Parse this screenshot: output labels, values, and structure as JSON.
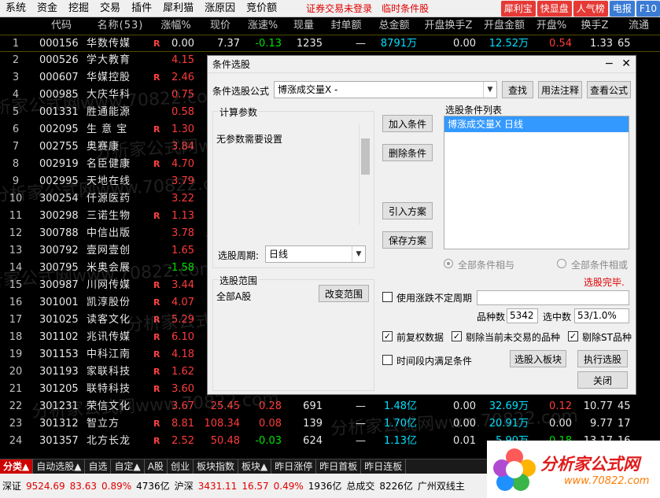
{
  "menu": {
    "items": [
      "系统",
      "资金",
      "挖掘",
      "交易",
      "插件",
      "犀利猫",
      "涨原因",
      "竞价额"
    ],
    "alert_login": "证券交易未登录",
    "alert_cond": "临时条件股",
    "pills": [
      "犀利宝",
      "快显盘",
      "人气榜",
      "电报",
      "F10"
    ]
  },
  "table": {
    "headers": [
      "",
      "代码",
      "名称(53)",
      "",
      "涨幅%",
      "现价",
      "涨速%",
      "现量",
      "封单额",
      "总金额",
      "开盘换手Z",
      "开盘金额",
      "开盘%",
      "换手Z",
      "流通"
    ],
    "rows": [
      {
        "idx": "1",
        "code": "000156",
        "name": "华数传媒",
        "r": "R",
        "chg": "0.00",
        "price": "7.37",
        "speed": "-0.13",
        "vol": "1235",
        "seal": "—",
        "amt": "8791万",
        "tor": "0.00",
        "oamt": "12.52万",
        "opct": "0.54",
        "turn": "1.33",
        "flow": "65",
        "dir": "flat",
        "pdir": "flat",
        "sdir": "dn",
        "odir": "up"
      },
      {
        "idx": "2",
        "code": "000526",
        "name": "学大教育",
        "r": "",
        "chg": "4.15",
        "price": "",
        "speed": "",
        "vol": "",
        "seal": "",
        "amt": "",
        "tor": "",
        "oamt": "",
        "opct": "",
        "turn": "",
        "flow": "",
        "dir": "up",
        "pdir": "up",
        "sdir": "up",
        "odir": "up"
      },
      {
        "idx": "3",
        "code": "000607",
        "name": "华媒控股",
        "r": "R",
        "chg": "2.46",
        "price": "",
        "speed": "",
        "vol": "",
        "seal": "",
        "amt": "",
        "tor": "",
        "oamt": "",
        "opct": "",
        "turn": "",
        "flow": "",
        "dir": "up",
        "pdir": "up",
        "sdir": "up",
        "odir": "up"
      },
      {
        "idx": "4",
        "code": "000985",
        "name": "大庆华科",
        "r": "",
        "chg": "0.75",
        "price": "",
        "speed": "",
        "vol": "",
        "seal": "",
        "amt": "",
        "tor": "",
        "oamt": "",
        "opct": "",
        "turn": "",
        "flow": "",
        "dir": "up",
        "pdir": "up",
        "sdir": "up",
        "odir": "up"
      },
      {
        "idx": "5",
        "code": "001331",
        "name": "胜通能源",
        "r": "",
        "chg": "0.58",
        "price": "",
        "speed": "",
        "vol": "",
        "seal": "",
        "amt": "",
        "tor": "",
        "oamt": "",
        "opct": "",
        "turn": "",
        "flow": "",
        "dir": "up",
        "pdir": "up",
        "sdir": "up",
        "odir": "up"
      },
      {
        "idx": "6",
        "code": "002095",
        "name": "生 意 宝",
        "r": "R",
        "chg": "1.30",
        "price": "",
        "speed": "",
        "vol": "",
        "seal": "",
        "amt": "",
        "tor": "",
        "oamt": "",
        "opct": "",
        "turn": "",
        "flow": "",
        "dir": "up",
        "pdir": "up",
        "sdir": "up",
        "odir": "up"
      },
      {
        "idx": "7",
        "code": "002755",
        "name": "奥赛康",
        "r": "",
        "chg": "3.84",
        "price": "",
        "speed": "",
        "vol": "",
        "seal": "",
        "amt": "",
        "tor": "",
        "oamt": "",
        "opct": "",
        "turn": "",
        "flow": "",
        "dir": "up",
        "pdir": "up",
        "sdir": "up",
        "odir": "up"
      },
      {
        "idx": "8",
        "code": "002919",
        "name": "名臣健康",
        "r": "R",
        "chg": "4.70",
        "price": "",
        "speed": "",
        "vol": "",
        "seal": "",
        "amt": "",
        "tor": "",
        "oamt": "",
        "opct": "",
        "turn": "",
        "flow": "",
        "dir": "up",
        "pdir": "up",
        "sdir": "up",
        "odir": "up"
      },
      {
        "idx": "9",
        "code": "002995",
        "name": "天地在线",
        "r": "",
        "chg": "3.79",
        "price": "",
        "speed": "",
        "vol": "",
        "seal": "",
        "amt": "",
        "tor": "",
        "oamt": "",
        "opct": "",
        "turn": "",
        "flow": "",
        "dir": "up",
        "pdir": "up",
        "sdir": "up",
        "odir": "up"
      },
      {
        "idx": "10",
        "code": "300254",
        "name": "仟源医药",
        "r": "",
        "chg": "3.22",
        "price": "",
        "speed": "",
        "vol": "",
        "seal": "",
        "amt": "",
        "tor": "",
        "oamt": "",
        "opct": "",
        "turn": "",
        "flow": "",
        "dir": "up",
        "pdir": "up",
        "sdir": "up",
        "odir": "up"
      },
      {
        "idx": "11",
        "code": "300298",
        "name": "三诺生物",
        "r": "R",
        "chg": "1.13",
        "price": "",
        "speed": "",
        "vol": "",
        "seal": "",
        "amt": "",
        "tor": "",
        "oamt": "",
        "opct": "",
        "turn": "",
        "flow": "",
        "dir": "up",
        "pdir": "up",
        "sdir": "up",
        "odir": "up"
      },
      {
        "idx": "12",
        "code": "300788",
        "name": "中信出版",
        "r": "",
        "chg": "3.78",
        "price": "",
        "speed": "",
        "vol": "",
        "seal": "",
        "amt": "",
        "tor": "",
        "oamt": "",
        "opct": "",
        "turn": "",
        "flow": "",
        "dir": "up",
        "pdir": "up",
        "sdir": "up",
        "odir": "up"
      },
      {
        "idx": "13",
        "code": "300792",
        "name": "壹网壹创",
        "r": "",
        "chg": "1.65",
        "price": "",
        "speed": "",
        "vol": "",
        "seal": "",
        "amt": "",
        "tor": "",
        "oamt": "",
        "opct": "",
        "turn": "",
        "flow": "",
        "dir": "up",
        "pdir": "up",
        "sdir": "up",
        "odir": "up"
      },
      {
        "idx": "14",
        "code": "300795",
        "name": "米奥会展",
        "r": "",
        "chg": "-1.58",
        "price": "",
        "speed": "",
        "vol": "",
        "seal": "",
        "amt": "",
        "tor": "",
        "oamt": "",
        "opct": "",
        "turn": "",
        "flow": "",
        "dir": "dn",
        "pdir": "dn",
        "sdir": "dn",
        "odir": "dn"
      },
      {
        "idx": "15",
        "code": "300987",
        "name": "川网传媒",
        "r": "R",
        "chg": "3.44",
        "price": "",
        "speed": "",
        "vol": "",
        "seal": "",
        "amt": "",
        "tor": "",
        "oamt": "",
        "opct": "",
        "turn": "",
        "flow": "",
        "dir": "up",
        "pdir": "up",
        "sdir": "up",
        "odir": "up"
      },
      {
        "idx": "16",
        "code": "301001",
        "name": "凯淳股份",
        "r": "R",
        "chg": "4.07",
        "price": "",
        "speed": "",
        "vol": "",
        "seal": "",
        "amt": "",
        "tor": "",
        "oamt": "",
        "opct": "",
        "turn": "",
        "flow": "",
        "dir": "up",
        "pdir": "up",
        "sdir": "up",
        "odir": "up"
      },
      {
        "idx": "17",
        "code": "301025",
        "name": "读客文化",
        "r": "R",
        "chg": "5.29",
        "price": "",
        "speed": "",
        "vol": "",
        "seal": "",
        "amt": "",
        "tor": "",
        "oamt": "",
        "opct": "",
        "turn": "",
        "flow": "",
        "dir": "up",
        "pdir": "up",
        "sdir": "up",
        "odir": "up"
      },
      {
        "idx": "18",
        "code": "301102",
        "name": "兆讯传媒",
        "r": "R",
        "chg": "6.10",
        "price": "",
        "speed": "",
        "vol": "",
        "seal": "",
        "amt": "",
        "tor": "",
        "oamt": "",
        "opct": "",
        "turn": "",
        "flow": "",
        "dir": "up",
        "pdir": "up",
        "sdir": "up",
        "odir": "up"
      },
      {
        "idx": "19",
        "code": "301153",
        "name": "中科江南",
        "r": "R",
        "chg": "4.18",
        "price": "",
        "speed": "",
        "vol": "",
        "seal": "",
        "amt": "",
        "tor": "",
        "oamt": "",
        "opct": "",
        "turn": "",
        "flow": "",
        "dir": "up",
        "pdir": "up",
        "sdir": "up",
        "odir": "up"
      },
      {
        "idx": "20",
        "code": "301193",
        "name": "家联科技",
        "r": "R",
        "chg": "1.62",
        "price": "",
        "speed": "",
        "vol": "",
        "seal": "",
        "amt": "",
        "tor": "",
        "oamt": "",
        "opct": "",
        "turn": "",
        "flow": "",
        "dir": "up",
        "pdir": "up",
        "sdir": "up",
        "odir": "up"
      },
      {
        "idx": "21",
        "code": "301205",
        "name": "联特科技",
        "r": "R",
        "chg": "3.60",
        "price": "",
        "speed": "",
        "vol": "",
        "seal": "",
        "amt": "",
        "tor": "",
        "oamt": "",
        "opct": "",
        "turn": "",
        "flow": "",
        "dir": "up",
        "pdir": "up",
        "sdir": "up",
        "odir": "up"
      },
      {
        "idx": "22",
        "code": "301231",
        "name": "荣信文化",
        "r": "",
        "chg": "3.67",
        "price": "25.45",
        "speed": "0.28",
        "vol": "691",
        "seal": "—",
        "amt": "1.48亿",
        "tor": "0.00",
        "oamt": "32.69万",
        "opct": "0.12",
        "turn": "10.77",
        "flow": "45",
        "dir": "up",
        "pdir": "up",
        "sdir": "up",
        "odir": "up"
      },
      {
        "idx": "23",
        "code": "301312",
        "name": "智立方",
        "r": "R",
        "chg": "8.81",
        "price": "108.34",
        "speed": "0.08",
        "vol": "139",
        "seal": "—",
        "amt": "1.70亿",
        "tor": "0.00",
        "oamt": "20.91万",
        "opct": "0.00",
        "turn": "9.77",
        "flow": "17",
        "dir": "up",
        "pdir": "up",
        "sdir": "up",
        "odir": "flat"
      },
      {
        "idx": "24",
        "code": "301357",
        "name": "北方长龙",
        "r": "R",
        "chg": "2.52",
        "price": "50.48",
        "speed": "-0.03",
        "vol": "624",
        "seal": "—",
        "amt": "1.13亿",
        "tor": "0.01",
        "oamt": "5.90万",
        "opct": "-0.18",
        "turn": "13.17",
        "flow": "16",
        "dir": "up",
        "pdir": "up",
        "sdir": "dn",
        "odir": "dn"
      }
    ]
  },
  "watermark": "分析家公式网www.70822.com",
  "tabs": [
    "分类▲",
    "自动选股▲",
    "自选",
    "自定▲",
    "A股",
    "创业",
    "板块指数",
    "板块▲",
    "昨日涨停",
    "昨日首板",
    "昨日连板"
  ],
  "status": {
    "sz_label": "深证",
    "sz_val": "9524.69",
    "sz_chg": "83.63",
    "sz_pct": "0.89%",
    "sz_amt": "4736亿",
    "hs_label": "沪深",
    "hs_val": "3431.11",
    "hs_chg": "16.57",
    "hs_pct": "0.49%",
    "hs_amt": "1936亿",
    "total_label": "总成交",
    "total_amt": "8226亿",
    "news": "广州双线主"
  },
  "logo": {
    "main": "分析家公式网",
    "sub": "www.70822.com"
  },
  "dialog": {
    "title": "条件选股",
    "formula_label": "条件选股公式",
    "formula_value": "博涨成交量X  -",
    "btn_find": "查找",
    "btn_usage": "用法注释",
    "btn_view": "查看公式",
    "params_title": "计算参数",
    "params_text": "无参数需要设置",
    "btn_add": "加入条件",
    "btn_delete": "删除条件",
    "btn_import": "引入方案",
    "btn_save": "保存方案",
    "list_title": "选股条件列表",
    "list_item": "博涨成交量X  日线",
    "period_label": "选股周期:",
    "period_value": "日线",
    "radio_and": "全部条件相与",
    "radio_or": "全部条件相或",
    "done_text": "选股完毕.",
    "range_title": "选股范围",
    "range_value": "全部A股",
    "btn_change": "改变范围",
    "chk_uncertain": "使用涨跌不定周期",
    "count_label": "品种数",
    "count_value": "5342",
    "selected_label": "选中数",
    "selected_value": "53/1.0%",
    "chk_adjust": "前复权数据",
    "chk_notrade": "剔除当前未交易的品种",
    "chk_st": "剔除ST品种",
    "chk_timeseg": "时间段内满足条件",
    "btn_to_block": "选股入板块",
    "btn_run": "执行选股",
    "btn_close": "关闭",
    "check_mark": "✓"
  }
}
